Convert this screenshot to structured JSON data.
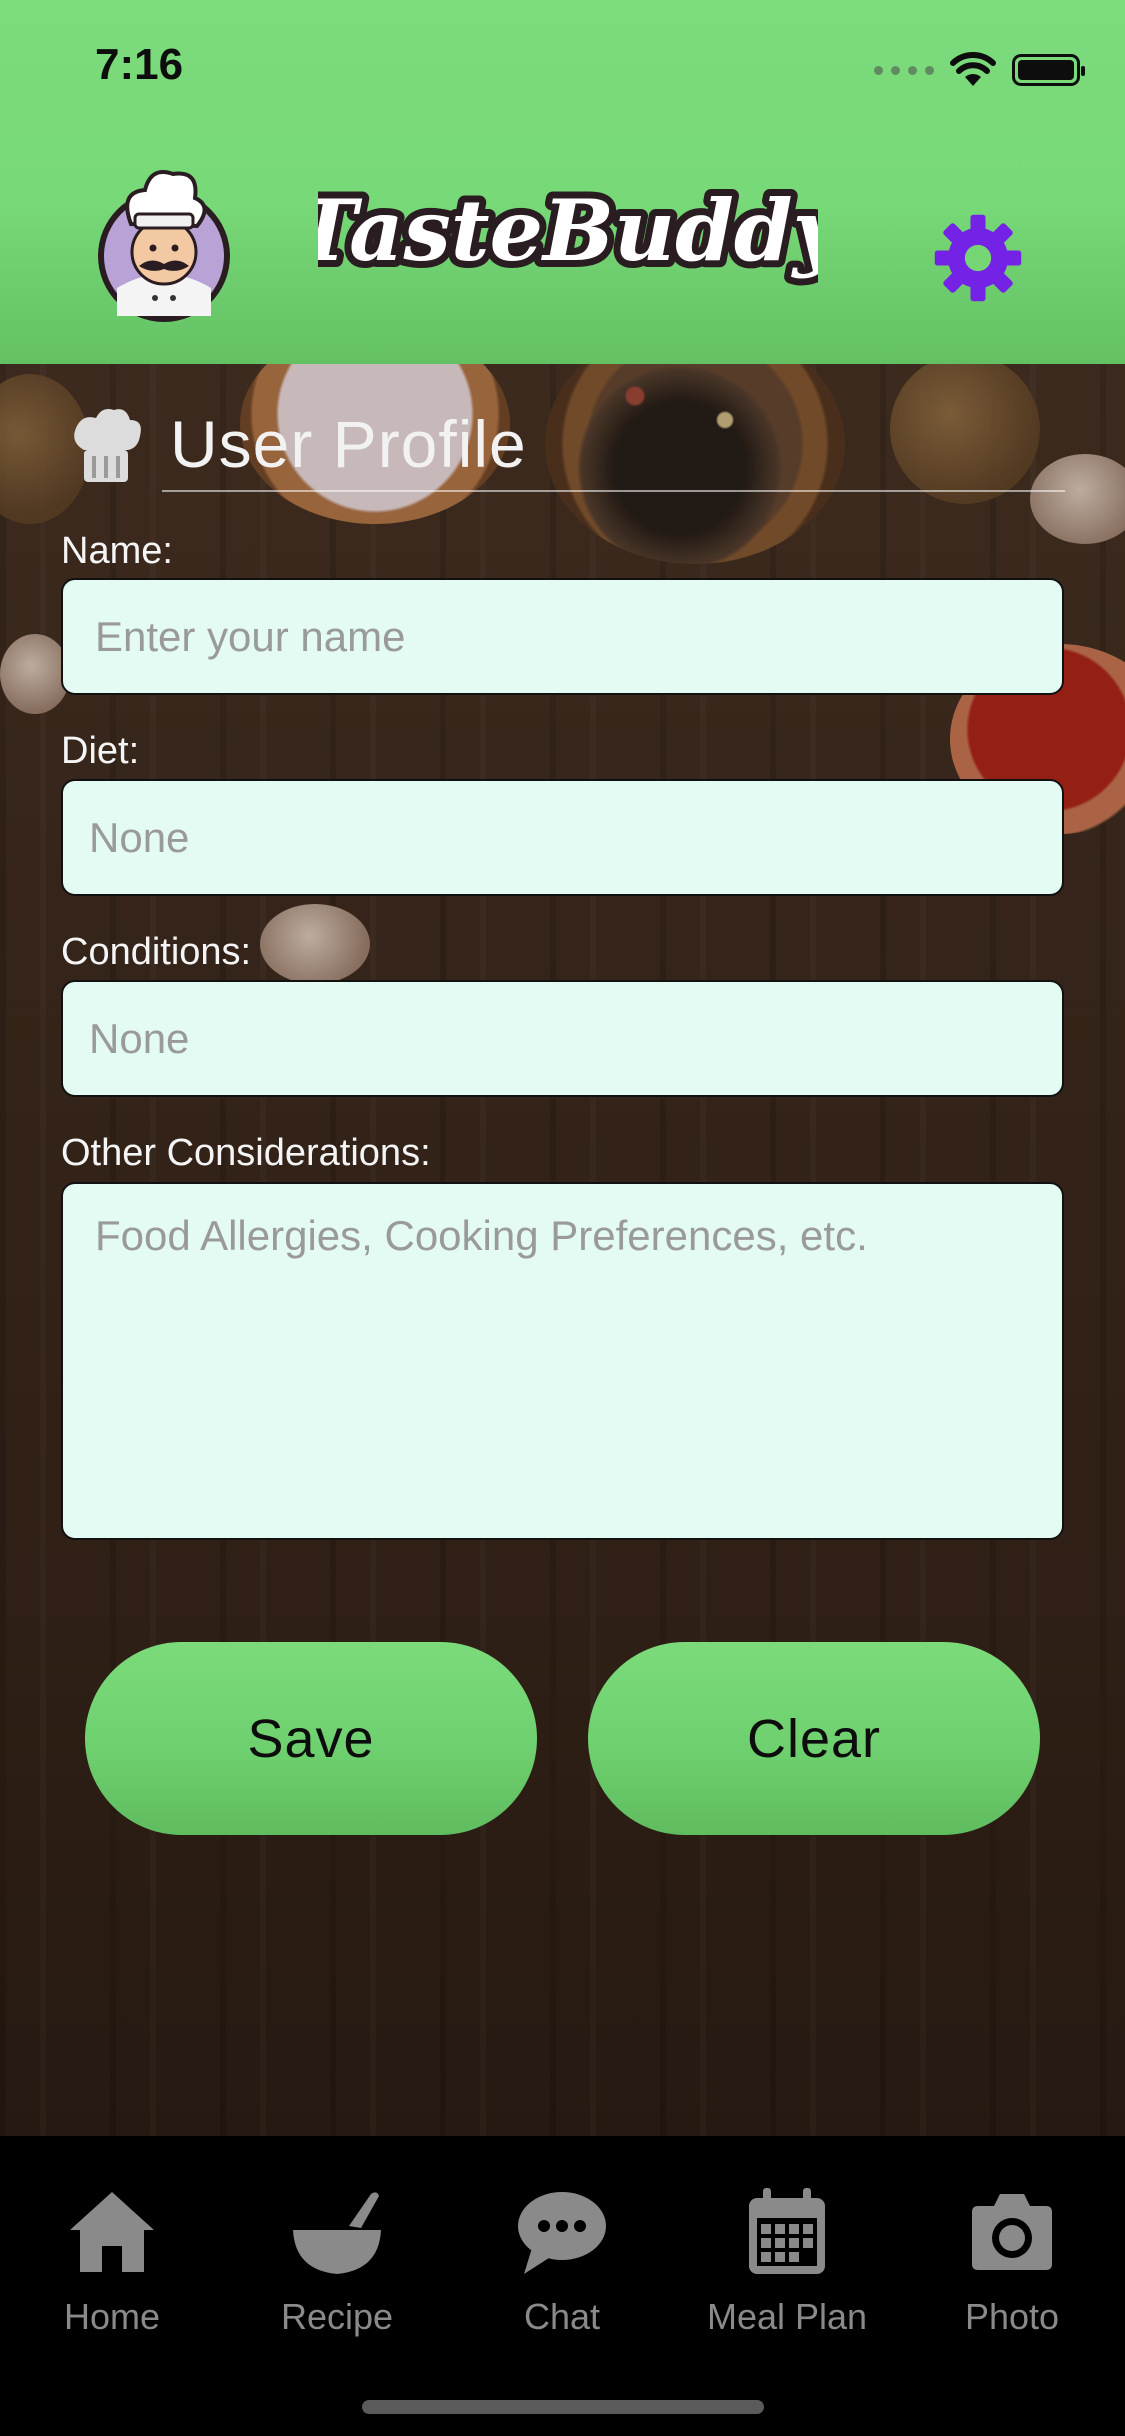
{
  "status_bar": {
    "time": "7:16"
  },
  "header": {
    "app_title": "TasteBuddy",
    "avatar": "chef-avatar",
    "settings_icon": "gear-icon",
    "accent_color": "#7322e6"
  },
  "profile": {
    "title": "User Profile",
    "title_icon": "chef-hat-icon",
    "fields": {
      "name": {
        "label": "Name:",
        "placeholder": "Enter your name",
        "value": ""
      },
      "diet": {
        "label": "Diet:",
        "placeholder": "None",
        "value": ""
      },
      "conditions": {
        "label": "Conditions:",
        "placeholder": "None",
        "value": ""
      },
      "other": {
        "label": "Other Considerations:",
        "placeholder": "Food Allergies, Cooking Preferences, etc.",
        "value": ""
      }
    },
    "buttons": {
      "save": "Save",
      "clear": "Clear"
    }
  },
  "tabbar": {
    "items": [
      {
        "label": "Home",
        "icon": "home-icon"
      },
      {
        "label": "Recipe",
        "icon": "bowl-icon"
      },
      {
        "label": "Chat",
        "icon": "chat-bubble-icon"
      },
      {
        "label": "Meal Plan",
        "icon": "calendar-icon"
      },
      {
        "label": "Photo",
        "icon": "camera-icon"
      }
    ]
  }
}
